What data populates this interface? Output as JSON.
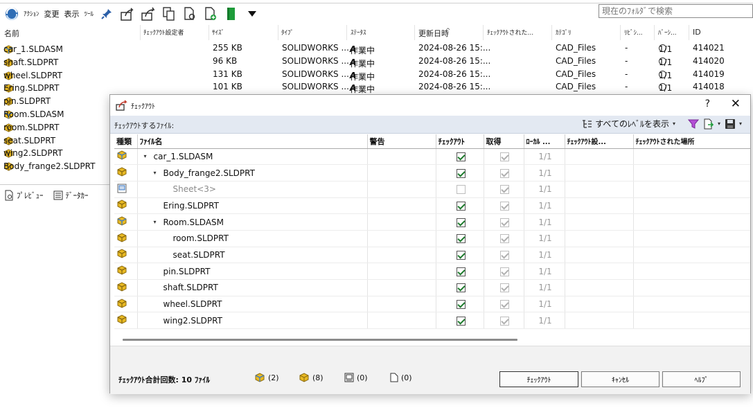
{
  "toolbar": {
    "menus": [
      "ｱｸｼｮﾝ",
      "変更",
      "表示",
      "ﾂｰﾙ"
    ],
    "search_placeholder": "現在のﾌｫﾙﾀﾞで検索",
    "icons": [
      "pin-icon",
      "share-icon",
      "share-alt-icon",
      "copy-tree-icon",
      "search-file-icon",
      "add-file-icon",
      "book-icon",
      "dropdown-triangle-icon"
    ]
  },
  "columns": [
    {
      "label": "名前"
    },
    {
      "label": "ﾁｪｯｸｱｳﾄ設定者"
    },
    {
      "label": "ｻｲｽﾞ"
    },
    {
      "label": "ﾀｲﾌﾟ"
    },
    {
      "label": "ｽﾃｰﾀｽ"
    },
    {
      "label": "更新日時"
    },
    {
      "label": "ﾁｪｯｸｱｳﾄされた..."
    },
    {
      "label": "ｶﾃｺﾞﾘ"
    },
    {
      "label": "ﾘﾋﾞｼ..."
    },
    {
      "label": "ﾊﾞｰｼ..."
    },
    {
      "label": "ID"
    }
  ],
  "files": [
    {
      "name": "car_1.SLDASM",
      "kind": "asm",
      "size": "255 KB",
      "type": "SOLIDWORKS ...",
      "status": "作業中",
      "modified": "2024-08-26 15:...",
      "category": "CAD_Files",
      "revision": "-",
      "version": "1/1",
      "id": "414021"
    },
    {
      "name": "shaft.SLDPRT",
      "kind": "part",
      "size": "96 KB",
      "type": "SOLIDWORKS ...",
      "status": "作業中",
      "modified": "2024-08-26 15:...",
      "category": "CAD_Files",
      "revision": "-",
      "version": "1/1",
      "id": "414020"
    },
    {
      "name": "wheel.SLDPRT",
      "kind": "part",
      "size": "131 KB",
      "type": "SOLIDWORKS ...",
      "status": "作業中",
      "modified": "2024-08-26 15:...",
      "category": "CAD_Files",
      "revision": "-",
      "version": "1/1",
      "id": "414019"
    },
    {
      "name": "Ering.SLDPRT",
      "kind": "part",
      "size": "101 KB",
      "type": "SOLIDWORKS ...",
      "status": "作業中",
      "modified": "2024-08-26 15:...",
      "category": "CAD_Files",
      "revision": "-",
      "version": "1/1",
      "id": "414018"
    },
    {
      "name": "pin.SLDPRT",
      "kind": "part"
    },
    {
      "name": "Room.SLDASM",
      "kind": "asm"
    },
    {
      "name": "room.SLDPRT",
      "kind": "part"
    },
    {
      "name": "seat.SLDPRT",
      "kind": "part"
    },
    {
      "name": "wing2.SLDPRT",
      "kind": "part"
    },
    {
      "name": "Body_frange2.SLDPRT",
      "kind": "part"
    }
  ],
  "bottom_tabs": [
    "ﾌﾟﾚﾋﾞｭｰ",
    "ﾃﾞｰﾀｶｰ"
  ],
  "dialog": {
    "title": "ﾁｪｯｸｱｳﾄ",
    "help_label": "?",
    "close_label": "✕",
    "files_label": "ﾁｪｯｸｱｳﾄするﾌｧｲﾙ:",
    "show_levels_label": "すべてのﾚﾍﾞﾙを表示",
    "grid_columns": [
      "種類",
      "ﾌｧｲﾙ名",
      "警告",
      "ﾁｪｯｸｱｳﾄ",
      "取得",
      "ﾛｰｶﾙ ...",
      "ﾁｪｯｸｱｳﾄ設...",
      "ﾁｪｯｸｱｳﾄされた場所"
    ],
    "rows": [
      {
        "name": "car_1.SLDASM",
        "kind": "asm",
        "indent": 0,
        "expander": "▾",
        "checkout": true,
        "get": true,
        "local": "1/1",
        "muted": false
      },
      {
        "name": "Body_frange2.SLDPRT",
        "kind": "part",
        "indent": 1,
        "expander": "▾",
        "checkout": true,
        "get": true,
        "local": "1/1",
        "muted": false
      },
      {
        "name": "Sheet<3>",
        "kind": "sheet",
        "indent": 2,
        "expander": "",
        "checkout": false,
        "get": true,
        "local": "1/1",
        "muted": true
      },
      {
        "name": "Ering.SLDPRT",
        "kind": "part",
        "indent": 1,
        "expander": "",
        "checkout": true,
        "get": true,
        "local": "1/1",
        "muted": false
      },
      {
        "name": "Room.SLDASM",
        "kind": "asm",
        "indent": 1,
        "expander": "▾",
        "checkout": true,
        "get": true,
        "local": "1/1",
        "muted": false
      },
      {
        "name": "room.SLDPRT",
        "kind": "part",
        "indent": 2,
        "expander": "",
        "checkout": true,
        "get": true,
        "local": "1/1",
        "muted": false
      },
      {
        "name": "seat.SLDPRT",
        "kind": "part",
        "indent": 2,
        "expander": "",
        "checkout": true,
        "get": true,
        "local": "1/1",
        "muted": false
      },
      {
        "name": "pin.SLDPRT",
        "kind": "part",
        "indent": 1,
        "expander": "",
        "checkout": true,
        "get": true,
        "local": "1/1",
        "muted": false
      },
      {
        "name": "shaft.SLDPRT",
        "kind": "part",
        "indent": 1,
        "expander": "",
        "checkout": true,
        "get": true,
        "local": "1/1",
        "muted": false
      },
      {
        "name": "wheel.SLDPRT",
        "kind": "part",
        "indent": 1,
        "expander": "",
        "checkout": true,
        "get": true,
        "local": "1/1",
        "muted": false
      },
      {
        "name": "wing2.SLDPRT",
        "kind": "part",
        "indent": 1,
        "expander": "",
        "checkout": true,
        "get": true,
        "local": "1/1",
        "muted": false
      }
    ],
    "total_label": "ﾁｪｯｸｱｳﾄ合計回数: 10 ﾌｧｲﾙ",
    "counts": [
      {
        "icon": "assembly-icon",
        "value": "(2)"
      },
      {
        "icon": "part-icon",
        "value": "(8)"
      },
      {
        "icon": "drawing-icon",
        "value": "(0)"
      },
      {
        "icon": "file-icon",
        "value": "(0)"
      }
    ],
    "buttons": {
      "checkout": "ﾁｪｯｸｱｳﾄ",
      "cancel": "ｷｬﾝｾﾙ",
      "help": "ﾍﾙﾌﾟ"
    }
  },
  "colors": {
    "part": "#e8b923",
    "asm": "#3a7bc8",
    "check": "#1d7a2c",
    "sub_bar": "#e3e9f2",
    "footer": "#f2f2f2"
  }
}
